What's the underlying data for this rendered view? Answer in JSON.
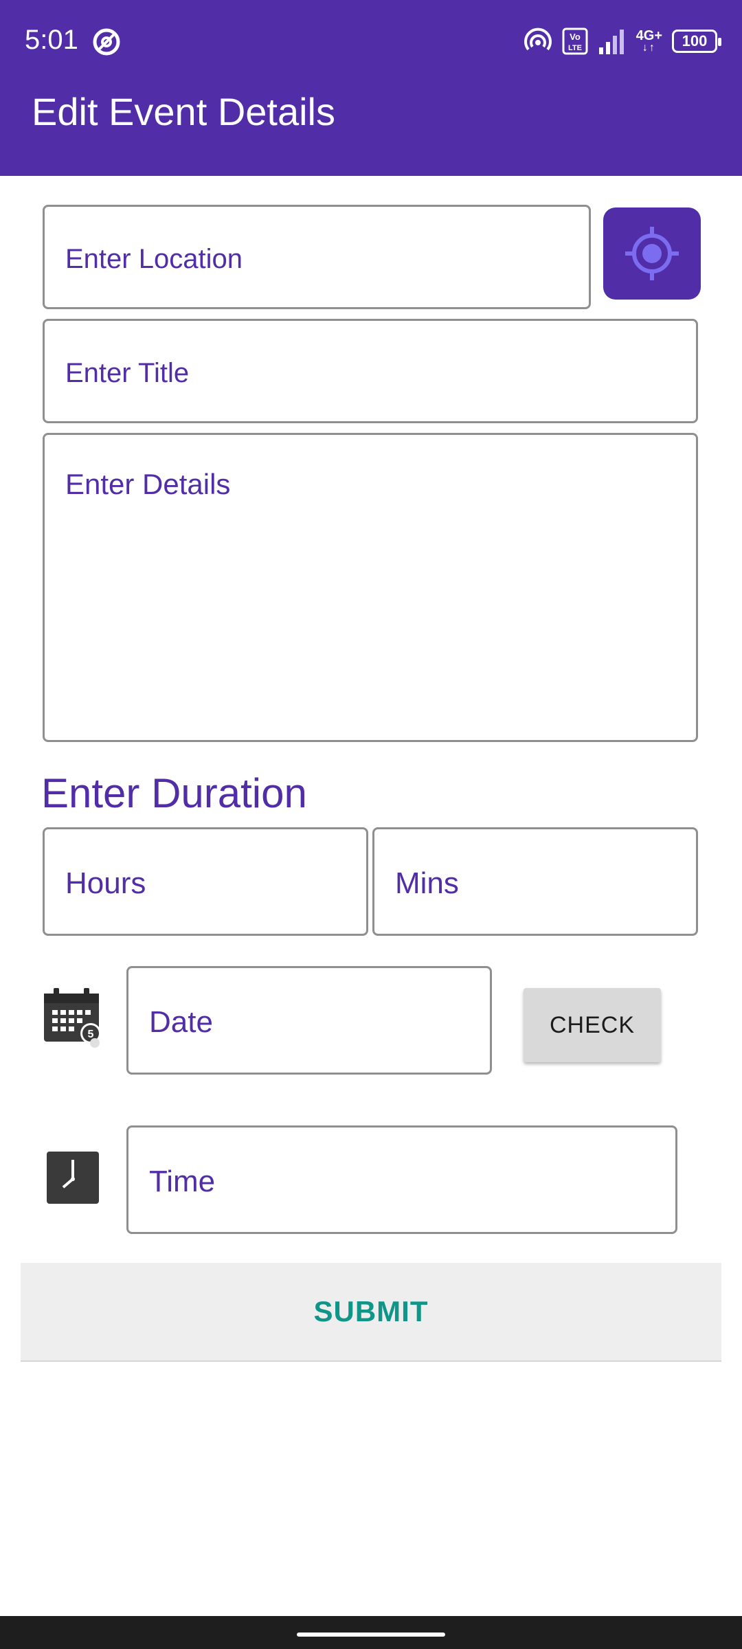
{
  "status_bar": {
    "time": "5:01",
    "network": "4G+",
    "battery": "100",
    "icons": [
      "data-saver-icon",
      "hotspot-icon",
      "volte-icon",
      "signal-icon",
      "network-4g-icon",
      "battery-icon"
    ]
  },
  "app_bar": {
    "title": "Edit Event Details"
  },
  "form": {
    "location_placeholder": "Enter Location",
    "title_placeholder": "Enter Title",
    "details_placeholder": "Enter Details",
    "duration_label": "Enter Duration",
    "hours_placeholder": "Hours",
    "mins_placeholder": "Mins",
    "date_placeholder": "Date",
    "check_label": "CHECK",
    "time_placeholder": "Time",
    "submit_label": "SUBMIT"
  },
  "colors": {
    "primary": "#512DA8",
    "hint_text": "#512DA8",
    "submit_text": "#0F9688",
    "locate_icon": "#7C6CF0"
  }
}
